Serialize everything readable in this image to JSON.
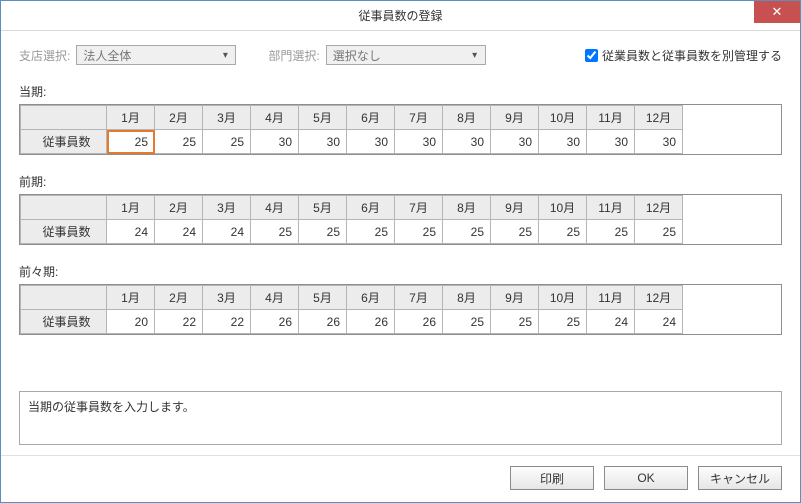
{
  "window": {
    "title": "従事員数の登録"
  },
  "toprow": {
    "branch_label": "支店選択:",
    "branch_value": "法人全体",
    "dept_label": "部門選択:",
    "dept_value": "選択なし",
    "checkbox_label": "従業員数と従事員数を別管理する"
  },
  "months": [
    "1月",
    "2月",
    "3月",
    "4月",
    "5月",
    "6月",
    "7月",
    "8月",
    "9月",
    "10月",
    "11月",
    "12月"
  ],
  "row_label": "従事員数",
  "sections": {
    "current": {
      "label": "当期:",
      "values": [
        25,
        25,
        25,
        30,
        30,
        30,
        30,
        30,
        30,
        30,
        30,
        30
      ],
      "selected_index": 0
    },
    "prev": {
      "label": "前期:",
      "values": [
        24,
        24,
        24,
        25,
        25,
        25,
        25,
        25,
        25,
        25,
        25,
        25
      ]
    },
    "prev2": {
      "label": "前々期:",
      "values": [
        20,
        22,
        22,
        26,
        26,
        26,
        26,
        25,
        25,
        25,
        24,
        24
      ]
    }
  },
  "hint": "当期の従事員数を入力します。",
  "buttons": {
    "print": "印刷",
    "ok": "OK",
    "cancel": "キャンセル"
  }
}
